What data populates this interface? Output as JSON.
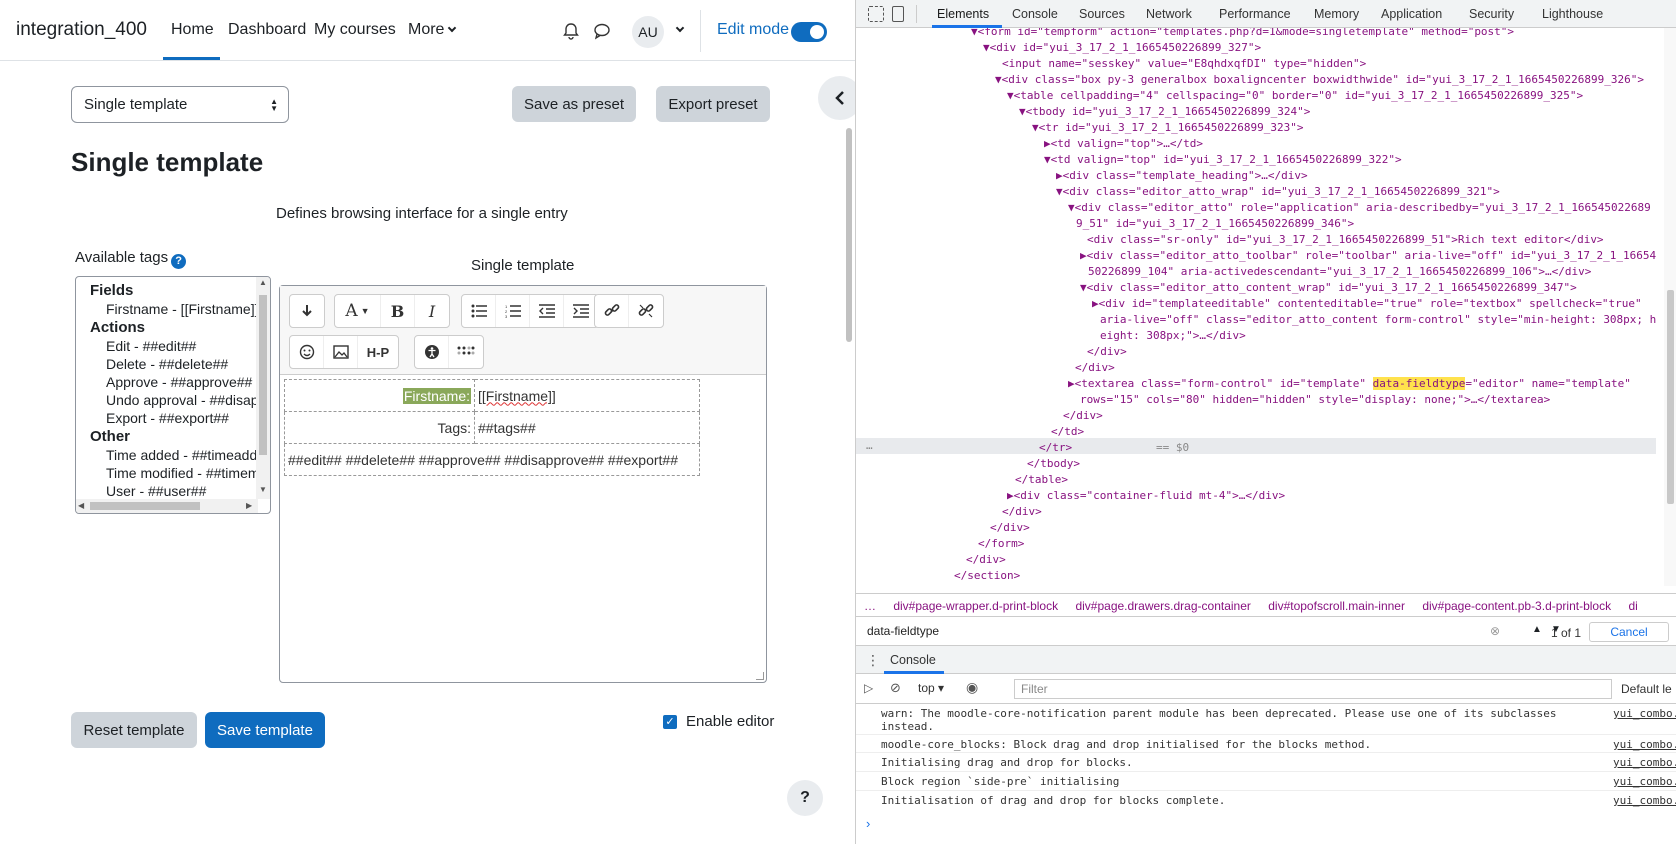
{
  "navbar": {
    "brand": "integration_400",
    "links": [
      "Home",
      "Dashboard",
      "My courses",
      "More"
    ],
    "avatar": "AU",
    "edit_mode": "Edit mode"
  },
  "template_select": {
    "value": "Single template"
  },
  "buttons": {
    "save_preset": "Save as preset",
    "export_preset": "Export preset",
    "reset_template": "Reset template",
    "save_template": "Save template"
  },
  "page_title": "Single template",
  "description": "Defines browsing interface for a single entry",
  "available_tags": {
    "label": "Available tags",
    "help": "?",
    "groups": [
      {
        "name": "Fields",
        "items": [
          "Firstname - [[Firstname]]"
        ]
      },
      {
        "name": "Actions",
        "items": [
          "Edit - ##edit##",
          "Delete - ##delete##",
          "Approve - ##approve##",
          "Undo approval - ##disapprove##",
          "Export - ##export##"
        ]
      },
      {
        "name": "Other",
        "items": [
          "Time added - ##timeadded##",
          "Time modified - ##timemodified##",
          "User - ##user##"
        ]
      }
    ]
  },
  "editor": {
    "label": "Single template",
    "rows": [
      {
        "label": "Firstname:",
        "value": "[[Firstname]]"
      },
      {
        "label": "Tags:",
        "value": "##tags##"
      },
      {
        "actions": "##edit## ##delete## ##approve## ##disapprove## ##export##"
      }
    ]
  },
  "enable_editor": "Enable editor",
  "help_float": "?",
  "devtools": {
    "tabs": [
      "Elements",
      "Console",
      "Sources",
      "Network",
      "Performance",
      "Memory",
      "Application",
      "Security",
      "Lighthouse"
    ],
    "breadcrumbs": [
      "…",
      "div#page-wrapper.d-print-block",
      "div#page.drawers.drag-container",
      "div#topofscroll.main-inner",
      "div#page-content.pb-3.d-print-block",
      "di"
    ],
    "search": {
      "value": "data-fieldtype",
      "count": "1 of 1",
      "cancel": "Cancel"
    },
    "console_label": "Console",
    "console_context": "top",
    "filter_placeholder": "Filter",
    "default_levels": "Default le",
    "selected_suffix": "== $0",
    "console_messages": [
      {
        "text": "warn: The moodle-core-notification parent module has been deprecated. Please use one of its subclasses instead.",
        "src": "yui_combo."
      },
      {
        "text": "moodle-core_blocks: Block drag and drop initialised for the blocks method.",
        "src": "yui_combo."
      },
      {
        "text": "Initialising drag and drop for blocks.",
        "src": "yui_combo."
      },
      {
        "text": "Block region `side-pre` initialising",
        "src": "yui_combo."
      },
      {
        "text": "Initialisation of drag and drop for blocks complete.",
        "src": "yui_combo."
      }
    ],
    "dom_lines": [
      "▼<form id=\"tempform\" action=\"templates.php?d=1&mode=singletemplate\" method=\"post\">",
      "▼<div id=\"yui_3_17_2_1_1665450226899_327\">",
      "<input name=\"sesskey\" value=\"E8qhdxqfDI\" type=\"hidden\">",
      "▼<div class=\"box py-3 generalbox boxaligncenter boxwidthwide\" id=\"yui_3_17_2_1_1665450226899_326\">",
      "▼<table cellpadding=\"4\" cellspacing=\"0\" border=\"0\" id=\"yui_3_17_2_1_1665450226899_325\">",
      "▼<tbody id=\"yui_3_17_2_1_1665450226899_324\">",
      "▼<tr id=\"yui_3_17_2_1_1665450226899_323\">",
      "▶<td valign=\"top\">…</td>",
      "▼<td valign=\"top\" id=\"yui_3_17_2_1_1665450226899_322\">",
      "▶<div class=\"template_heading\">…</div>",
      "▼<div class=\"editor_atto_wrap\" id=\"yui_3_17_2_1_1665450226899_321\">",
      "▼<div class=\"editor_atto\" role=\"application\" aria-describedby=\"yui_3_17_2_1_166545022689",
      "9_51\" id=\"yui_3_17_2_1_1665450226899_346\">",
      "<div class=\"sr-only\" id=\"yui_3_17_2_1_1665450226899_51\">Rich text editor</div>",
      "▶<div class=\"editor_atto_toolbar\" role=\"toolbar\" aria-live=\"off\" id=\"yui_3_17_2_1_16654",
      "50226899_104\" aria-activedescendant=\"yui_3_17_2_1_1665450226899_106\">…</div>",
      "▼<div class=\"editor_atto_content_wrap\" id=\"yui_3_17_2_1_1665450226899_347\">",
      "▶<div id=\"templateeditable\" contenteditable=\"true\" role=\"textbox\" spellcheck=\"true\"",
      "aria-live=\"off\" class=\"editor_atto_content form-control\" style=\"min-height: 308px; h",
      "eight: 308px;\">…</div>",
      "</div>",
      "</div>",
      "▶<textarea class=\"form-control\" id=\"template\" data-fieldtype=\"editor\" name=\"template\"",
      "rows=\"15\" cols=\"80\" hidden=\"hidden\" style=\"display: none;\">…</textarea>",
      "</div>",
      "</td>",
      "</tr>",
      "</tbody>",
      "</table>",
      "▶<div class=\"container-fluid mt-4\">…</div>",
      "</div>",
      "</div>",
      "</form>",
      "</div>",
      "</section>"
    ]
  },
  "colors": {
    "primary": "#0f6cbf",
    "secondary_btn": "#ced4da",
    "devtools_blue": "#1a73e8",
    "highlight": "#ffe24d"
  }
}
